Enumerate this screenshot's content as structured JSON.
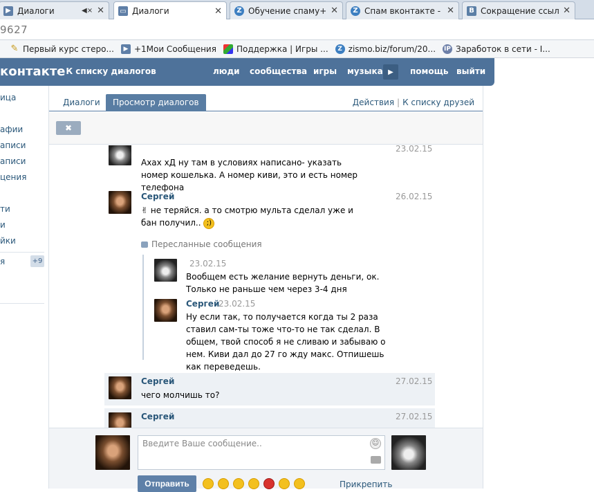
{
  "browser": {
    "tabs": [
      {
        "title": "Диалоги",
        "favicon": "page-icon",
        "active": false
      },
      {
        "title": "Диалоги",
        "favicon": "chat-icon",
        "active": true
      },
      {
        "title": "Обучение спаму+ до",
        "favicon": "z-icon",
        "active": false
      },
      {
        "title": "Спам вконтакте - Ба",
        "favicon": "z-icon",
        "active": false
      },
      {
        "title": "Сокращение ссылок",
        "favicon": "vk-icon",
        "active": false
      }
    ],
    "address": "9627",
    "bookmarks": [
      {
        "label": "Первый курс стеро...",
        "icon": "pen-icon"
      },
      {
        "label": "+1Мои Сообщения",
        "icon": "page-icon"
      },
      {
        "label": "Поддержка | Игры ...",
        "icon": "cube-icon"
      },
      {
        "label": "zismo.biz/forum/20...",
        "icon": "z-icon"
      },
      {
        "label": "Заработок в сети - I...",
        "icon": "ip-icon"
      }
    ]
  },
  "header": {
    "logo": "контакте",
    "back": "К списку диалогов",
    "nav": [
      "люди",
      "сообщества",
      "игры",
      "музыка",
      "помощь",
      "выйти"
    ]
  },
  "leftmenu": {
    "items": [
      "ица",
      "афии",
      "аписи",
      "аписи",
      "цения",
      "",
      "ти",
      "и",
      "йки"
    ],
    "last": "я",
    "badge": "+9"
  },
  "panel": {
    "tabs": [
      "Диалоги",
      "Просмотр диалогов"
    ],
    "links": [
      "Действия",
      "К списку друзей"
    ],
    "delete_symbol": "✖"
  },
  "messages": [
    {
      "author": "",
      "date": "23.02.15",
      "text": "Ахах хД ну там в условиях написано- указать номер кошелька. А номер киви, это и есть номер телефона"
    },
    {
      "author": "Сергей",
      "date": "26.02.15",
      "text": "не теряйся. а то смотрю мульта сделал уже и бан получил.."
    },
    {
      "forward_label": "Пересланные сообщения"
    },
    {
      "author": "",
      "date": "23.02.15",
      "text": "Вообщем есть желание вернуть деньги, ок. Только не раньше чем через 3-4 дня"
    },
    {
      "author": "Сергей",
      "date": "23.02.15",
      "text": "Ну если так, то получается когда ты 2 раза ставил сам-ты тоже что-то не так сделал. В общем, твой способ я не сливаю и забываю о нем. Киви дал до 27 го жду макс. Отпишешь как переведешь."
    },
    {
      "author": "Сергей",
      "date": "27.02.15",
      "text": "чего молчишь то?"
    },
    {
      "author": "Сергей",
      "date": "27.02.15",
      "text": ""
    }
  ],
  "composer": {
    "placeholder": "Введите Ваше сообщение..",
    "send": "Отправить",
    "attach": "Прикрепить"
  }
}
